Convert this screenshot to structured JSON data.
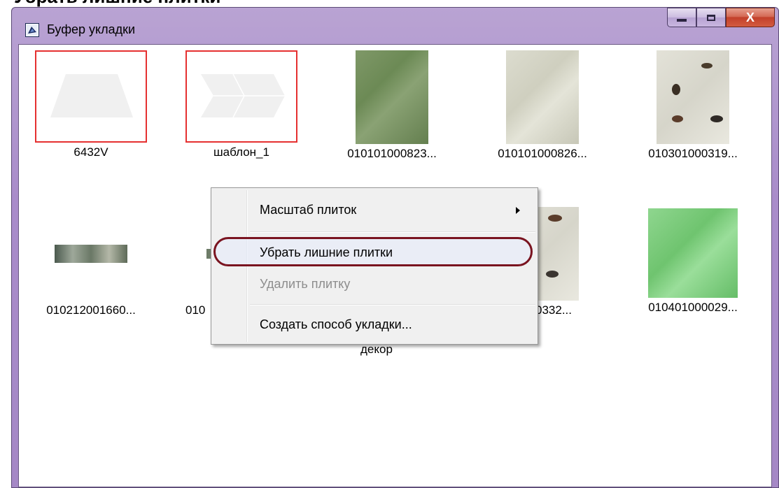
{
  "heading": "Убрать лишние плитки",
  "window": {
    "title": "Буфер укладки",
    "buttons": {
      "minimize": "minimize",
      "maximize": "maximize",
      "close": "X"
    }
  },
  "tiles": [
    {
      "label": "6432V"
    },
    {
      "label": "шаблон_1"
    },
    {
      "label": "010101000823..."
    },
    {
      "label": "010101000826..."
    },
    {
      "label": "010301000319..."
    },
    {
      "label": "010212001660..."
    },
    {
      "label": "010"
    },
    {
      "label": "декор"
    },
    {
      "label": "000332..."
    },
    {
      "label": "010401000029..."
    }
  ],
  "context_menu": {
    "items": [
      {
        "label": "Масштаб плиток",
        "has_submenu": true
      },
      {
        "label": "Убрать лишние плитки",
        "highlighted": true
      },
      {
        "label": "Удалить плитку",
        "disabled": true
      },
      {
        "label": "Создать способ укладки..."
      }
    ]
  },
  "colors": {
    "accent_frame": "#a98cca",
    "selection_border": "#e53030",
    "highlight_ring": "#7a1420"
  }
}
